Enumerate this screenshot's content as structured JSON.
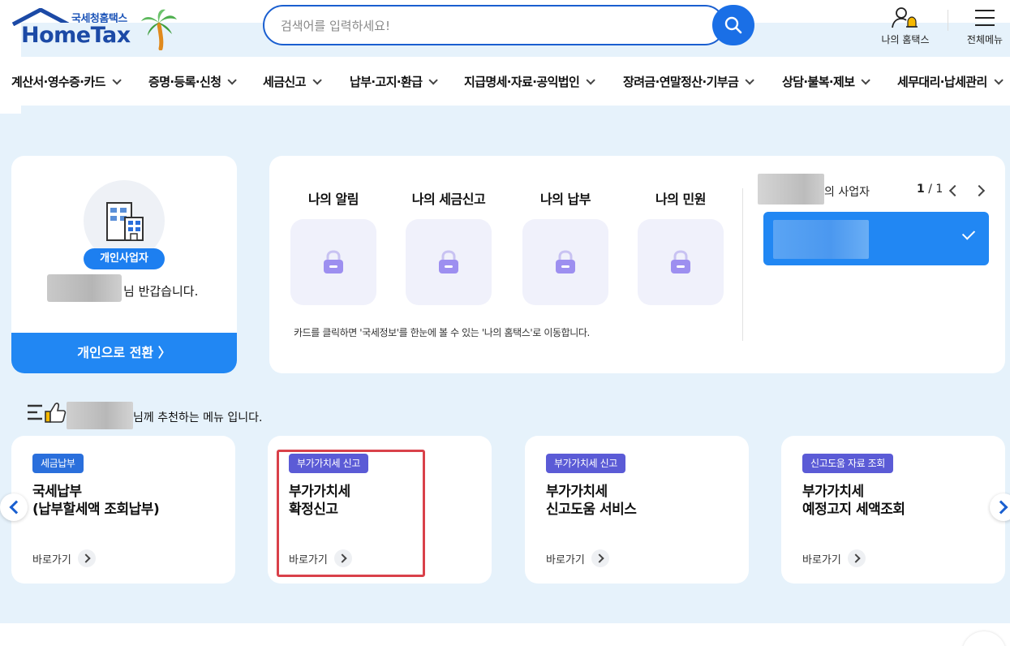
{
  "header": {
    "logo_sub": "국세청홈택스",
    "logo_main": "HomeTax",
    "search_placeholder": "검색어를 입력하세요!",
    "my_hometax_label": "나의 홈택스",
    "all_menu_label": "전체메뉴"
  },
  "nav": {
    "items": [
      "계산서·영수증·카드",
      "증명·등록·신청",
      "세금신고",
      "납부·고지·환급",
      "지급명세·자료·공익법인",
      "장려금·연말정산·기부금",
      "상담·불복·제보",
      "세무대리·납세관리"
    ]
  },
  "profile": {
    "badge": "개인사업자",
    "greeting": "님 반갑습니다.",
    "switch_label": "개인으로 전환 〉"
  },
  "info": {
    "tiles": [
      "나의 알림",
      "나의 세금신고",
      "나의 납부",
      "나의 민원"
    ],
    "note": "카드를 클릭하면 '국세정보'를 한눈에 볼 수 있는 '나의 홈택스'로 이동합니다.",
    "biz_label": "의 사업자",
    "page_current": "1",
    "page_total": "/ 1"
  },
  "recommend": {
    "title_suffix": "님께 추천하는 메뉴 입니다.",
    "cards": [
      {
        "tag": "세금납부",
        "tag_color": "#2a6fdc",
        "title": "국세납부\n(납부할세액 조회납부)",
        "go": "바로가기"
      },
      {
        "tag": "부가가치세 신고",
        "tag_color": "#5b5bd6",
        "title": "부가가치세\n확정신고",
        "go": "바로가기"
      },
      {
        "tag": "부가가치세 신고",
        "tag_color": "#5b5bd6",
        "title": "부가가치세\n신고도움 서비스",
        "go": "바로가기"
      },
      {
        "tag": "신고도움 자료 조회",
        "tag_color": "#5b5bd6",
        "title": "부가가치세\n예정고지 세액조회",
        "go": "바로가기"
      }
    ]
  },
  "colors": {
    "primary": "#2187f3",
    "background": "#e6f2fb",
    "highlight": "#d9414a"
  }
}
